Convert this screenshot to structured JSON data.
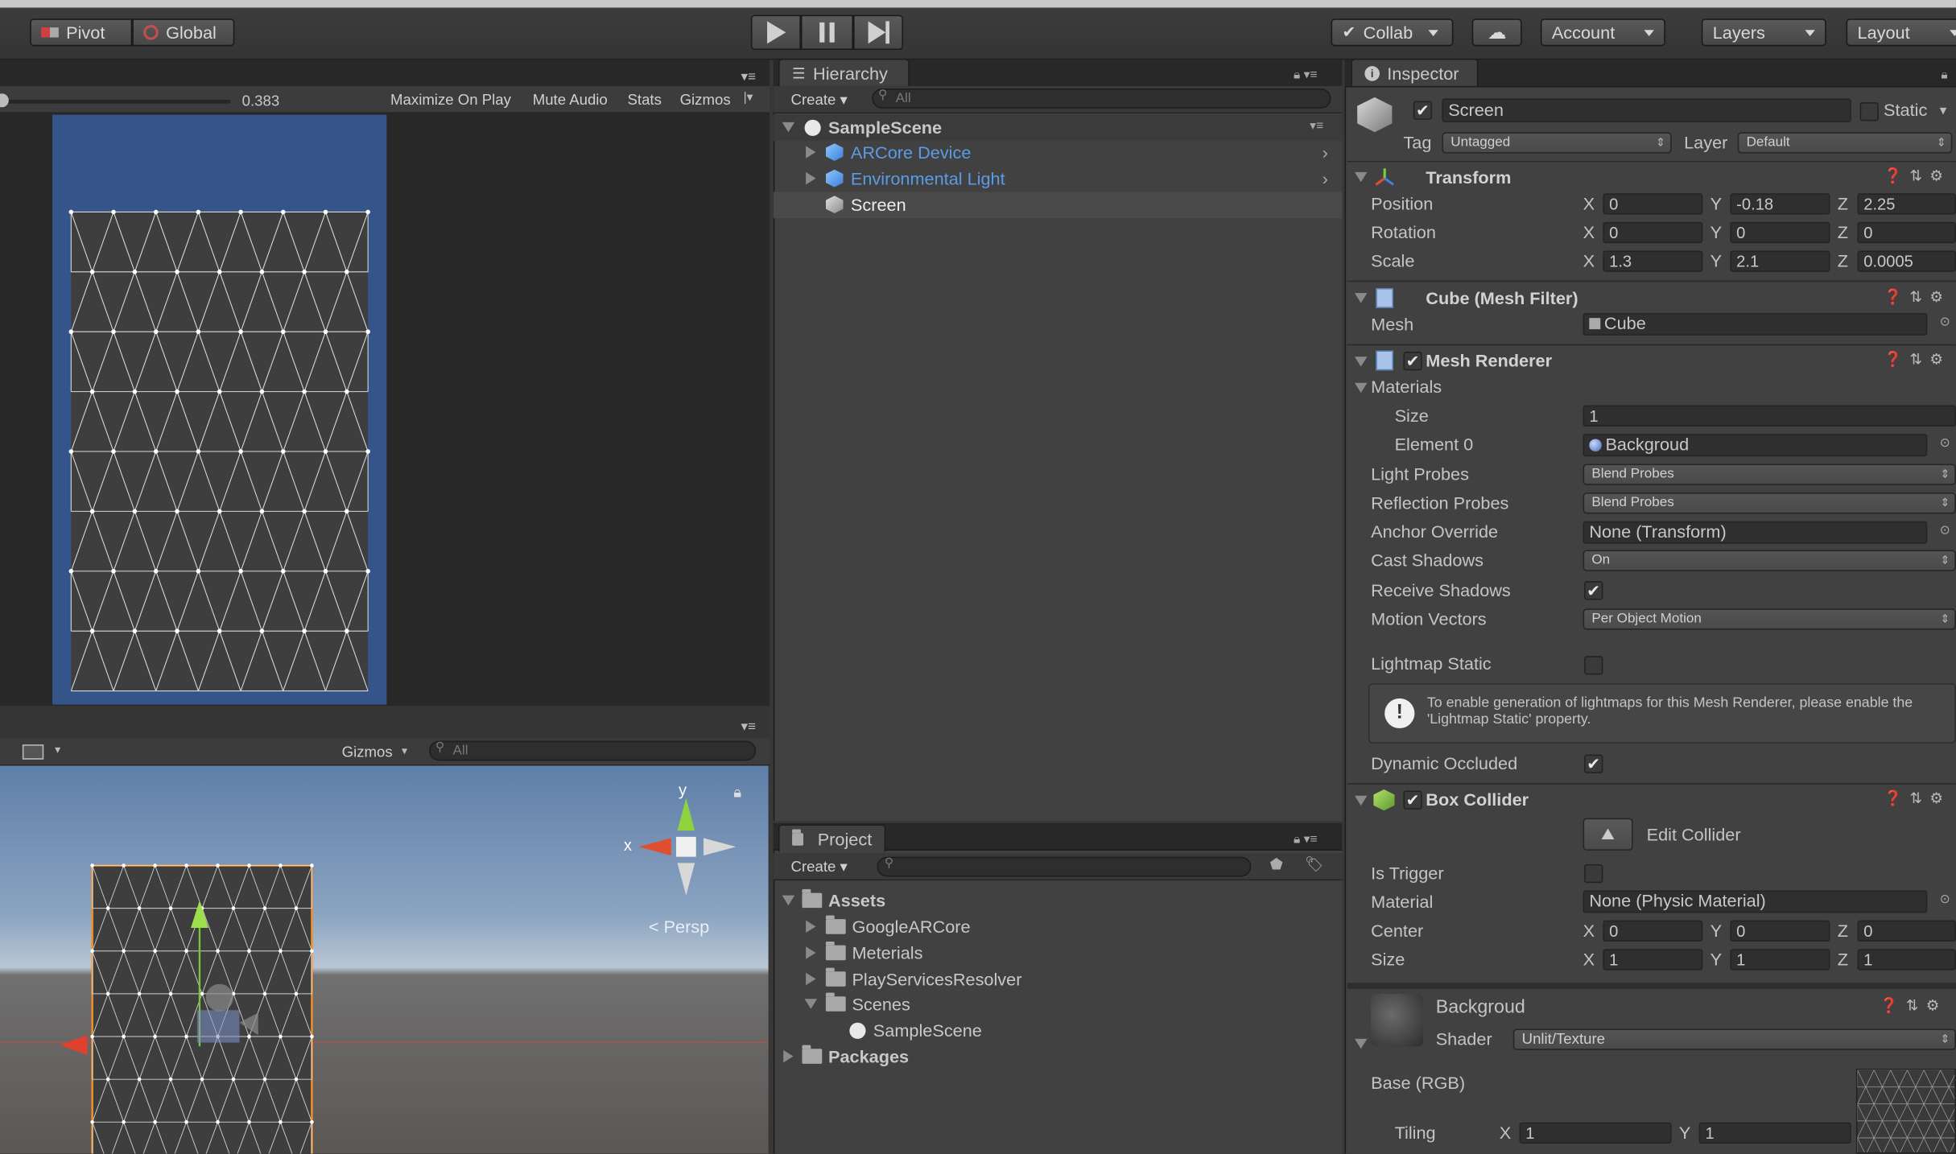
{
  "toolbar": {
    "pivot": "Pivot",
    "global": "Global",
    "collab": "Collab",
    "account": "Account",
    "layers": "Layers",
    "layout": "Layout",
    "play_icon": "play-icon",
    "pause_icon": "pause-icon",
    "step_icon": "step-icon"
  },
  "game_view": {
    "scale_value": "0.383",
    "maximize_on_play": "Maximize On Play",
    "mute_audio": "Mute Audio",
    "stats": "Stats",
    "gizmos": "Gizmos"
  },
  "scene_view": {
    "gizmos": "Gizmos",
    "search_placeholder": "All",
    "axis_x": "x",
    "axis_y": "y",
    "persp": "< Persp"
  },
  "hierarchy": {
    "tab": "Hierarchy",
    "create": "Create",
    "search_placeholder": "All",
    "scene": "SampleScene",
    "items": [
      {
        "label": "ARCore Device"
      },
      {
        "label": "Environmental Light"
      },
      {
        "label": "Screen"
      }
    ]
  },
  "project": {
    "tab": "Project",
    "create": "Create",
    "tree": [
      {
        "label": "Assets"
      },
      {
        "label": "GoogleARCore"
      },
      {
        "label": "Meterials"
      },
      {
        "label": "PlayServicesResolver"
      },
      {
        "label": "Scenes"
      },
      {
        "label": "SampleScene"
      },
      {
        "label": "Packages"
      }
    ]
  },
  "inspector": {
    "tab": "Inspector",
    "object_name": "Screen",
    "static": "Static",
    "tag_label": "Tag",
    "tag_value": "Untagged",
    "layer_label": "Layer",
    "layer_value": "Default",
    "transform": {
      "title": "Transform",
      "position_label": "Position",
      "rotation_label": "Rotation",
      "scale_label": "Scale",
      "position": {
        "x": "0",
        "y": "-0.18",
        "z": "2.25"
      },
      "rotation": {
        "x": "0",
        "y": "0",
        "z": "0"
      },
      "scale": {
        "x": "1.3",
        "y": "2.1",
        "z": "0.0005"
      }
    },
    "mesh_filter": {
      "title": "Cube (Mesh Filter)",
      "mesh_label": "Mesh",
      "mesh_value": "Cube"
    },
    "mesh_renderer": {
      "title": "Mesh Renderer",
      "materials": "Materials",
      "size_label": "Size",
      "size_value": "1",
      "element0_label": "Element 0",
      "element0_value": "Backgroud",
      "light_probes_label": "Light Probes",
      "light_probes_value": "Blend Probes",
      "reflection_probes_label": "Reflection Probes",
      "reflection_probes_value": "Blend Probes",
      "anchor_override_label": "Anchor Override",
      "anchor_override_value": "None (Transform)",
      "cast_shadows_label": "Cast Shadows",
      "cast_shadows_value": "On",
      "receive_shadows_label": "Receive Shadows",
      "motion_vectors_label": "Motion Vectors",
      "motion_vectors_value": "Per Object Motion",
      "lightmap_static_label": "Lightmap Static",
      "info_text": "To enable generation of lightmaps for this Mesh Renderer, please enable the 'Lightmap Static' property.",
      "dynamic_occluded_label": "Dynamic Occluded"
    },
    "box_collider": {
      "title": "Box Collider",
      "edit_collider": "Edit Collider",
      "is_trigger_label": "Is Trigger",
      "material_label": "Material",
      "material_value": "None (Physic Material)",
      "center_label": "Center",
      "size_label": "Size",
      "center": {
        "x": "0",
        "y": "0",
        "z": "0"
      },
      "size": {
        "x": "1",
        "y": "1",
        "z": "1"
      }
    },
    "material": {
      "name": "Backgroud",
      "shader_label": "Shader",
      "shader_value": "Unlit/Texture",
      "base_label": "Base (RGB)",
      "tiling_label": "Tiling",
      "tiling": {
        "x": "1",
        "y": "1"
      }
    },
    "axis": {
      "x": "X",
      "y": "Y",
      "z": "Z"
    }
  }
}
